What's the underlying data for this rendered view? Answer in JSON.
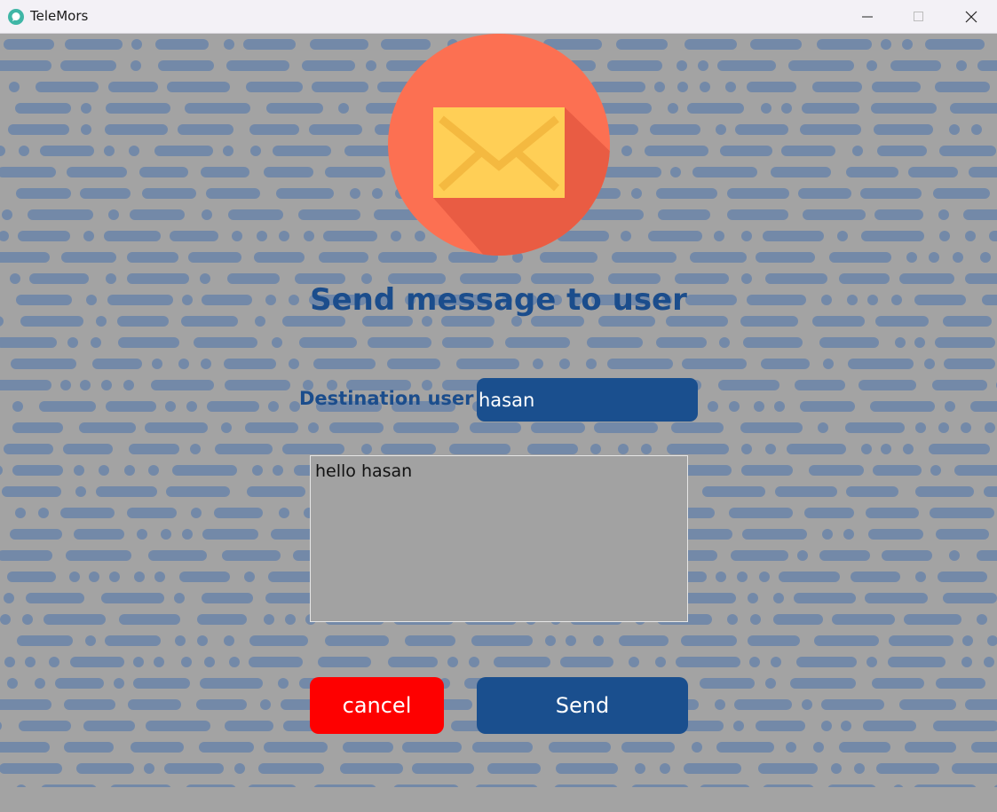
{
  "window": {
    "title": "TeleMors",
    "controls": [
      "minimize",
      "maximize",
      "close"
    ]
  },
  "icons": {
    "app": "chat-bubble-icon",
    "hero": "envelope-icon"
  },
  "form": {
    "title": "Send message to user",
    "destination_label": "Destination user",
    "destination_value": "hasan",
    "message_value": "hello hasan"
  },
  "buttons": {
    "cancel_label": "cancel",
    "send_label": "Send"
  },
  "colors": {
    "accent_blue": "#1a4f8e",
    "cancel_red": "#fe0000",
    "logo_circle": "#fc7052",
    "envelope": "#ffcf56"
  }
}
